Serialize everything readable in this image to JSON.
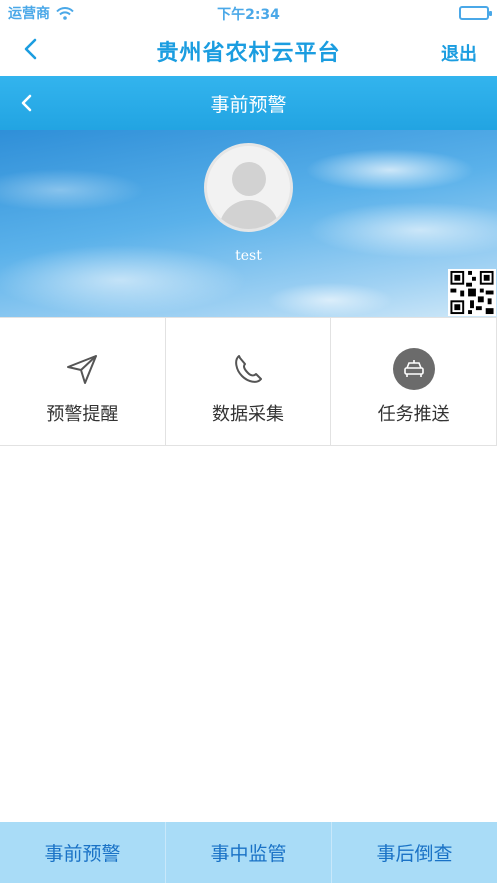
{
  "status_bar": {
    "carrier": "运营商",
    "time": "下午2:34"
  },
  "app_header": {
    "title": "贵州省农村云平台",
    "exit_label": "退出"
  },
  "page_header": {
    "title": "事前预警"
  },
  "profile": {
    "username": "test"
  },
  "menu": {
    "items": [
      {
        "label": "预警提醒",
        "icon": "navigation-arrow-icon"
      },
      {
        "label": "数据采集",
        "icon": "phone-icon"
      },
      {
        "label": "任务推送",
        "icon": "car-icon"
      }
    ]
  },
  "tabbar": {
    "tabs": [
      {
        "label": "事前预警"
      },
      {
        "label": "事中监管"
      },
      {
        "label": "事后倒查"
      }
    ]
  },
  "colors": {
    "accent": "#1b9de0",
    "header_bg": "#22a4e2",
    "tabbar_bg": "#a9dcf7",
    "tab_text": "#1a72c6"
  }
}
